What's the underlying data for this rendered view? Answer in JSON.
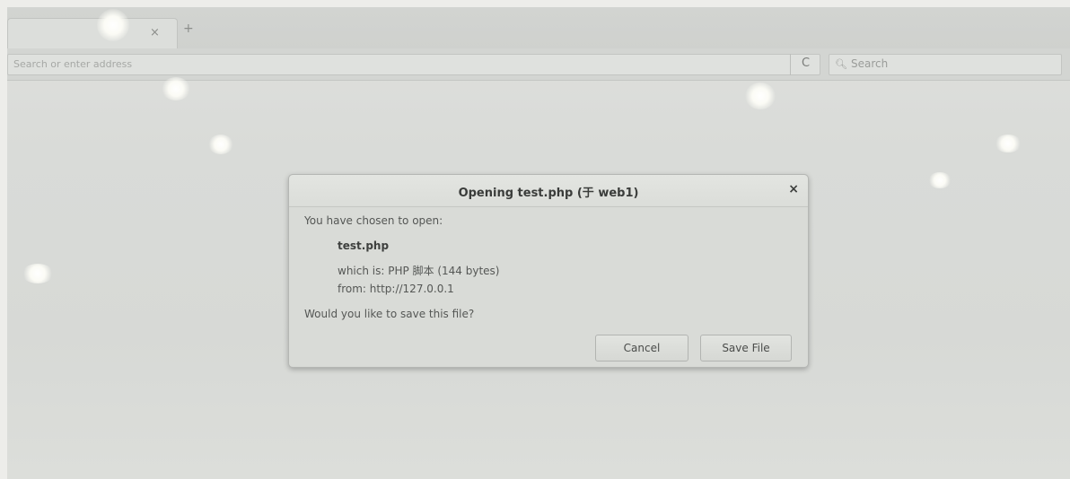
{
  "browser": {
    "url_placeholder": "Search or enter address",
    "reload_icon": "C",
    "search_placeholder": "Search",
    "tab_close": "×",
    "new_tab": "+"
  },
  "dialog": {
    "title": "Opening test.php (于 web1)",
    "close": "×",
    "intro": "You have chosen to open:",
    "filename": "test.php",
    "filetype": "which is: PHP 脚本 (144 bytes)",
    "from": "from: http://127.0.0.1",
    "question": "Would you like to save this file?",
    "cancel_label": "Cancel",
    "save_label": "Save File"
  }
}
